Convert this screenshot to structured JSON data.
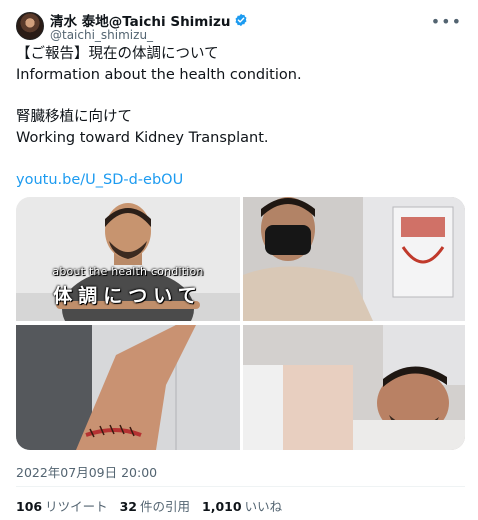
{
  "author": {
    "display_name": "清水 泰地@Taichi Shimizu",
    "handle": "@taichi_shimizu_",
    "verified": true,
    "verified_color": "#1d9bf0"
  },
  "more_icon": "more-options-icon",
  "tweet": {
    "lines": [
      "【ご報告】現在の体調について",
      "Information about  the health condition.",
      "腎臓移植に向けて",
      "Working toward Kidney Transplant."
    ],
    "link": "youtu.be/U_SD-d-ebOU",
    "link_color": "#1d9bf0"
  },
  "media": {
    "caption_en": "about the health condition",
    "caption_jp": "体調について"
  },
  "timestamp": "2022年07月09日 20:00",
  "stats": [
    {
      "count": "106",
      "label": "リツイート"
    },
    {
      "count": "32",
      "label": "件の引用"
    },
    {
      "count": "1,010",
      "label": "いいね"
    }
  ]
}
